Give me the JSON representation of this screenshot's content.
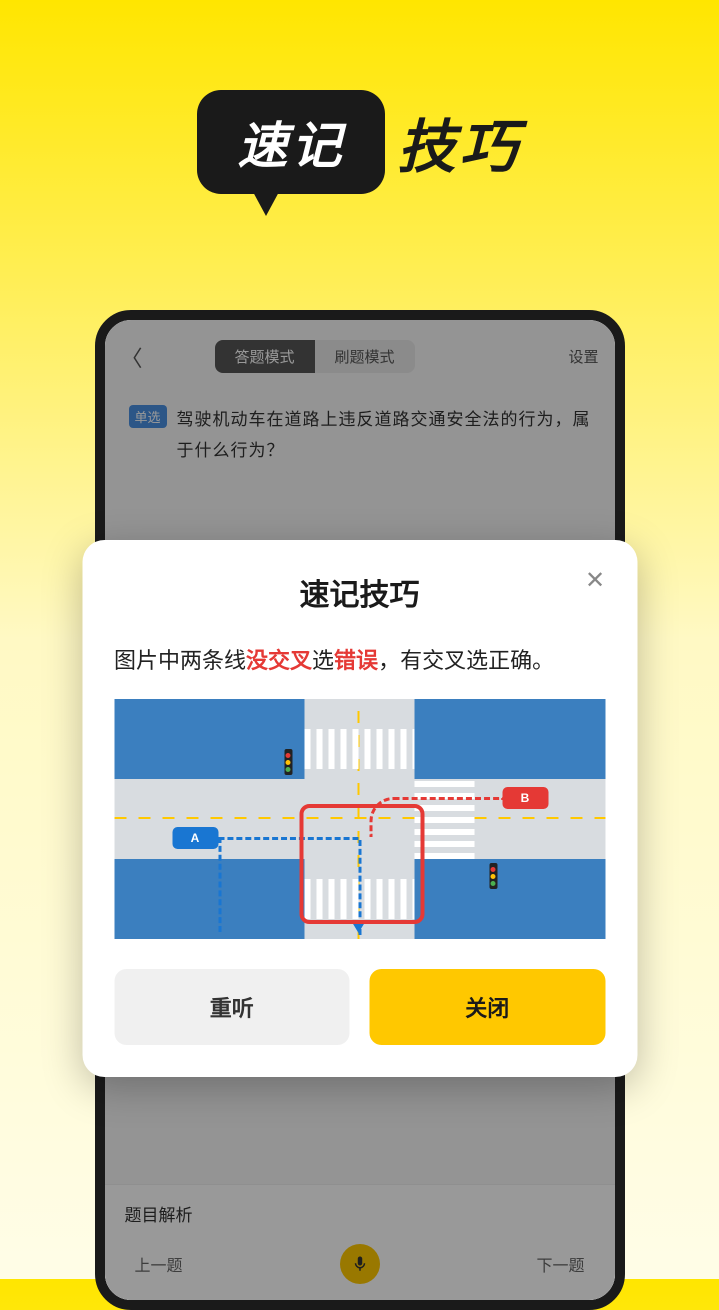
{
  "hero": {
    "bubble": "速记",
    "right": "技巧"
  },
  "phone": {
    "topbar": {
      "tab_active": "答题模式",
      "tab_inactive": "刷题模式",
      "settings": "设置"
    },
    "question": {
      "badge": "单选",
      "text": "驾驶机动车在道路上违反道路交通安全法的行为，属于什么行为？"
    },
    "bottom": {
      "section": "题目解析",
      "prev": "上一题",
      "next": "下一题"
    }
  },
  "modal": {
    "title": "速记技巧",
    "tip_prefix": "图片中两条线",
    "tip_red1": "没交叉",
    "tip_mid1": "选",
    "tip_red2": "错误",
    "tip_mid2": "，有交叉选",
    "tip_suffix": "正确。",
    "car_a": "A",
    "car_b": "B",
    "btn_replay": "重听",
    "btn_close": "关闭"
  }
}
